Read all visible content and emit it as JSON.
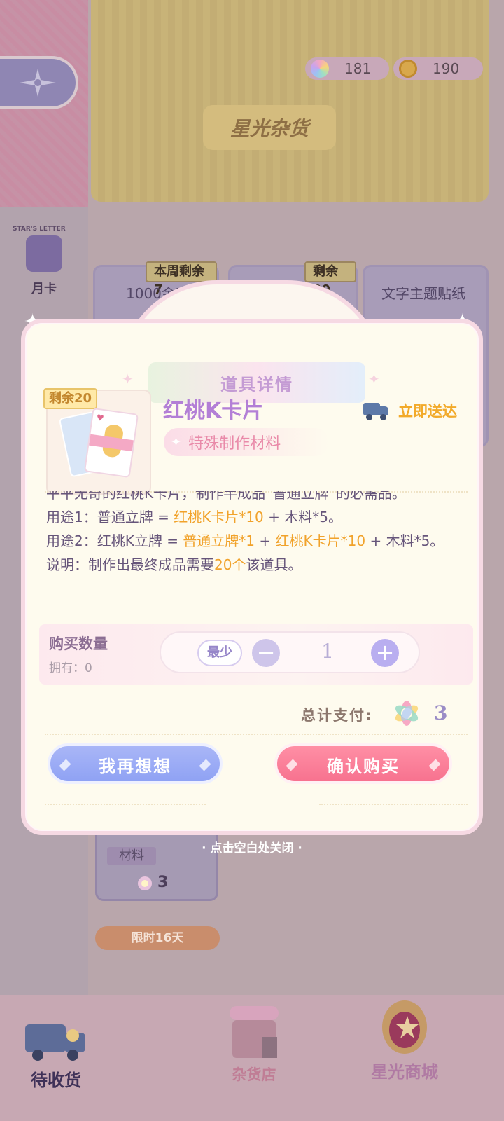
{
  "header": {
    "banner_title": "星光杂货",
    "currency": [
      {
        "icon": "rainbow-gem-icon",
        "value": "181"
      },
      {
        "icon": "gold-coin-icon",
        "value": "190"
      }
    ]
  },
  "sidebar": {
    "letter_tag": "STAR'S LETTER",
    "items": [
      {
        "label": "月卡"
      }
    ]
  },
  "shop": {
    "cards": [
      {
        "badge": "本周剩余7",
        "text": "1000金币"
      },
      {
        "badge": "剩余20",
        "text": ""
      },
      {
        "badge": "",
        "text": "文字主题贴纸"
      }
    ],
    "bottom_card": {
      "tag": "材料",
      "price": "3",
      "timer": "限时16天"
    }
  },
  "modal": {
    "title": "道具详情",
    "stock_badge": "剩余20",
    "item_name": "红桃K卡片",
    "item_type": "特殊制作材料",
    "delivery": "立即送达",
    "desc": {
      "line1": "平平无奇的红桃K卡片，制作半成品“普通立牌”的必需品。",
      "use1_prefix": "用途1：普通立牌 = ",
      "use1_hl": "红桃K卡片*10",
      "use1_suffix": " + 木料*5。",
      "use2_prefix": "用途2：红桃K立牌 = ",
      "use2_hl1": "普通立牌*1",
      "use2_mid": " + ",
      "use2_hl2": "红桃K卡片*10",
      "use2_suffix": " + 木料*5。",
      "note_prefix": "说明：制作出最终成品需要",
      "note_hl": "20个",
      "note_suffix": "该道具。"
    },
    "qty_label": "购买数量",
    "owned_label": "拥有：0",
    "min_label": "最少",
    "qty_value": "1",
    "total_label": "总计支付:",
    "total_value": "3",
    "cancel_label": "我再想想",
    "confirm_label": "确认购买",
    "close_hint": "· 点击空白处关闭 ·"
  },
  "bottom_nav": {
    "items": [
      {
        "label": "待收货"
      },
      {
        "label": "杂货店"
      },
      {
        "label": "星光商城"
      }
    ]
  },
  "colors": {
    "accent_purple": "#b37fd6",
    "highlight_orange": "#f1a22a",
    "confirm_pink": "#f7728f",
    "cancel_blue": "#8fa2f4"
  }
}
